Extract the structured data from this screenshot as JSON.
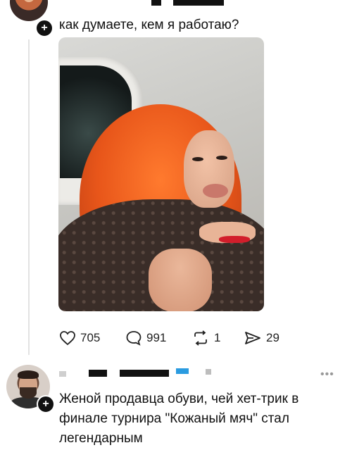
{
  "post": {
    "text": "как думаете, кем я работаю?",
    "stats": {
      "likes": "705",
      "comments": "991",
      "reposts": "1",
      "shares": "29"
    }
  },
  "reply": {
    "text_lines": [
      "Женой продавца обуви, чей хет-трик в",
      "финале турнира \"Кожаный мяч\" стал",
      "легендарным"
    ],
    "more": "•••"
  },
  "icons": [
    "heart-icon",
    "comment-icon",
    "repost-icon",
    "share-icon",
    "plus-icon"
  ],
  "colors": {
    "text": "#111111",
    "accent_blue": "#2a9be0",
    "thread_line": "#e3e3e3"
  }
}
